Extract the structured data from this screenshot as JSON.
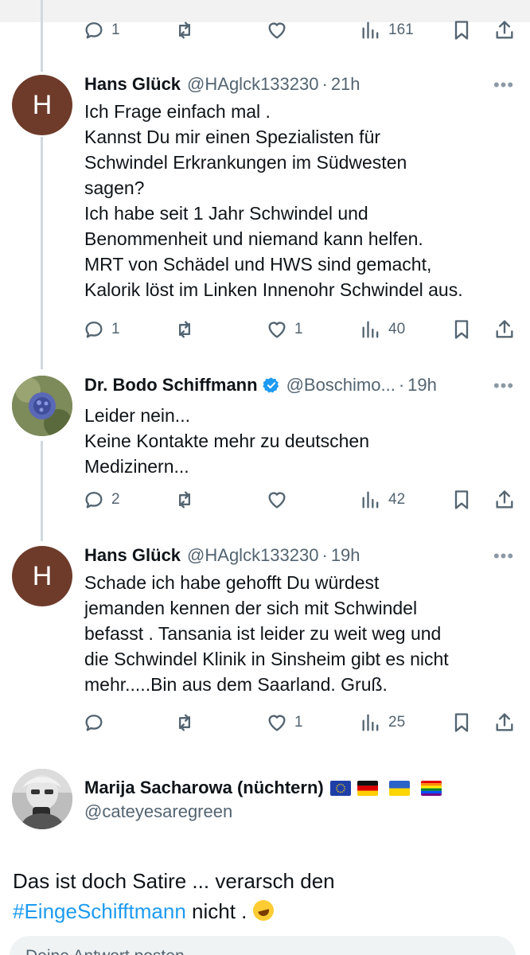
{
  "prev_tweet_actions": {
    "reply_count": "1",
    "repost_count": "",
    "like_count": "",
    "views_count": "161"
  },
  "tweets": [
    {
      "avatar_letter": "H",
      "name": "Hans Glück",
      "handle": "@HAglck133230",
      "time": "21h",
      "text": "Ich Frage einfach mal .\nKannst Du mir einen Spezialisten für\nSchwindel Erkrankungen  im Südwesten\nsagen?\nIch habe seit 1 Jahr Schwindel und\nBenommenheit und niemand kann helfen.\nMRT von Schädel und HWS sind gemacht,\nKalorik löst im Linken Innenohr Schwindel aus.",
      "reply_count": "1",
      "repost_count": "",
      "like_count": "1",
      "views_count": "40"
    },
    {
      "avatar_icon": "thistle-flower-avatar",
      "name": "Dr. Bodo Schiffmann",
      "handle": "@Boschimo...",
      "time": "19h",
      "verified": true,
      "text": "Leider nein...\nKeine Kontakte mehr zu deutschen\nMedizinern...",
      "reply_count": "2",
      "repost_count": "",
      "like_count": "",
      "views_count": "42"
    },
    {
      "avatar_letter": "H",
      "name": "Hans Glück",
      "handle": "@HAglck133230",
      "time": "19h",
      "text": "Schade ich habe gehofft Du würdest\njemanden kennen der sich mit Schwindel\nbefasst . Tansania ist leider zu weit weg und\ndie Schwindel Klinik in Sinsheim gibt es nicht\nmehr.....Bin aus dem Saarland. Gruß.",
      "reply_count": "",
      "repost_count": "",
      "like_count": "1",
      "views_count": "25"
    }
  ],
  "main_tweet": {
    "name": "Marija Sacharowa (nüchtern)",
    "handle": "@cateyesaregreen",
    "flags": [
      "eu-flag-icon",
      "germany-flag-icon",
      "ukraine-flag-icon",
      "rainbow-flag-icon"
    ],
    "text_before": "Das ist doch Satire ... verarsch den",
    "hashtag": "#EingeSchifftmann",
    "text_after": " nicht .",
    "emoji": "rolling-laughing-icon"
  },
  "compose": {
    "placeholder": "Deine Antwort posten"
  },
  "colors": {
    "accent": "#1d9bf0",
    "text": "#0f1419",
    "muted": "#536471",
    "thread_line": "#cfd9de",
    "avatar_brown": "#6e3b2a"
  }
}
